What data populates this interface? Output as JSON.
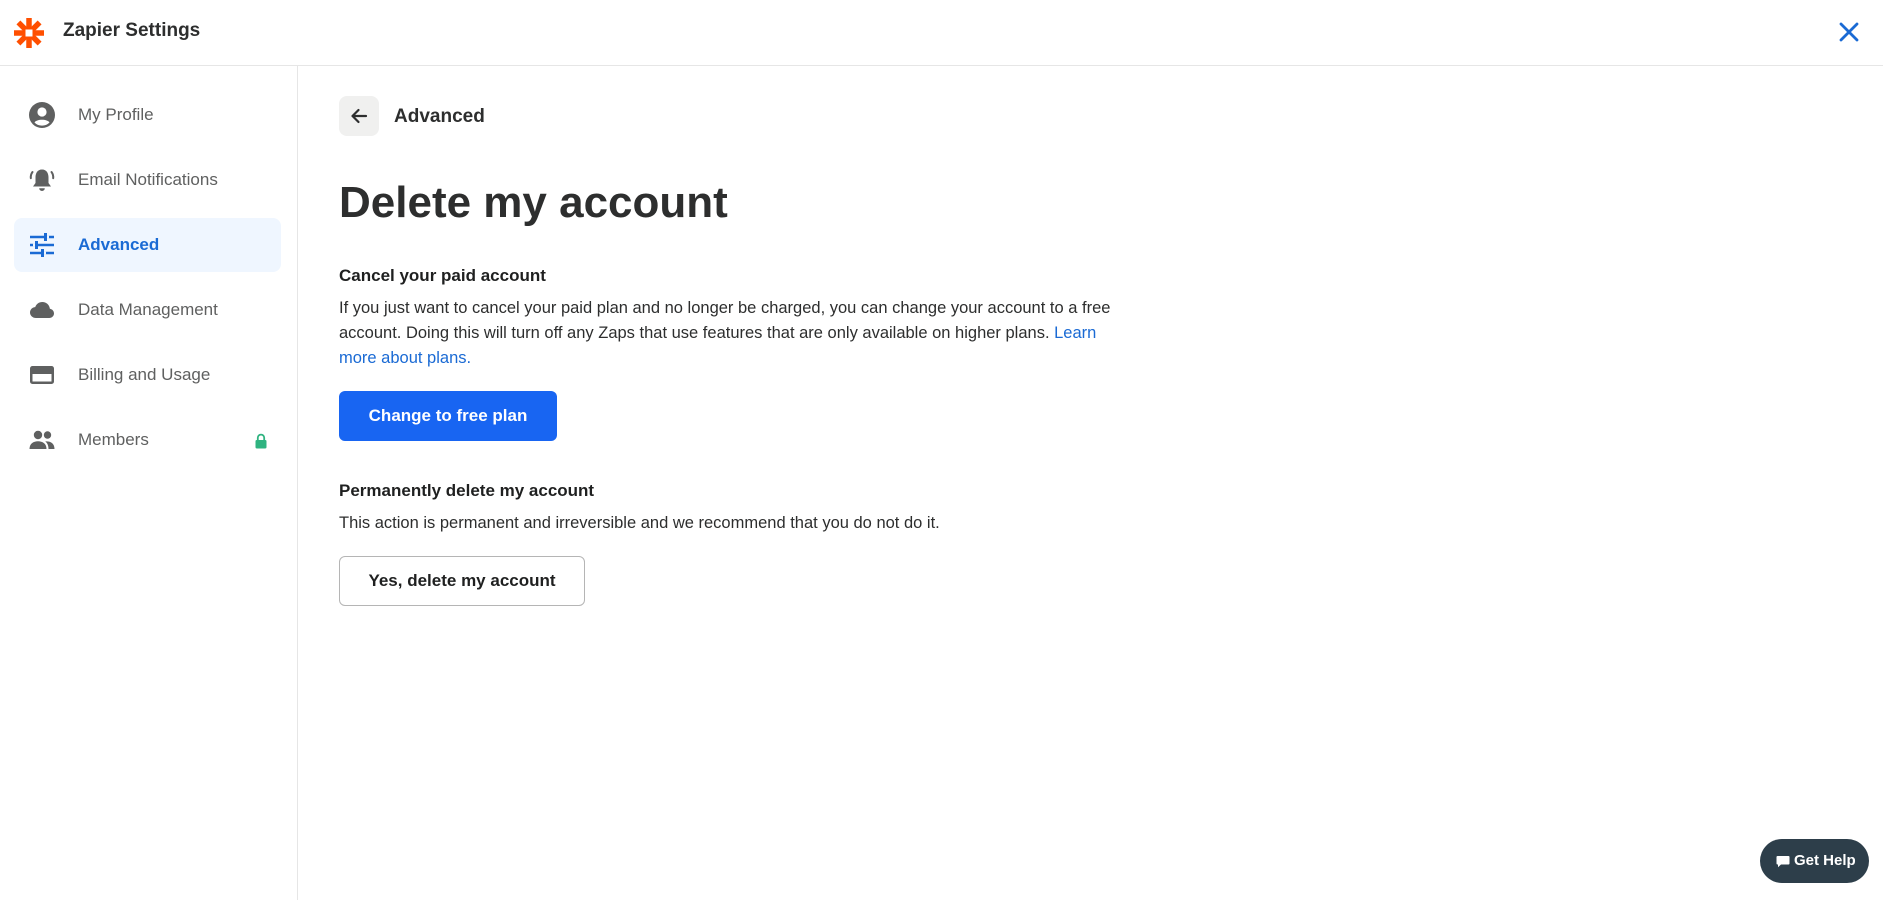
{
  "header": {
    "title": "Zapier Settings",
    "logo_icon": "zapier-asterisk-logo",
    "close_icon": "close-icon",
    "brand_color": "#ff4f00",
    "close_color": "#1a6ad4"
  },
  "sidebar": {
    "items": [
      {
        "label": "My Profile",
        "icon": "account-circle-icon",
        "active": false
      },
      {
        "label": "Email Notifications",
        "icon": "bell-icon",
        "active": false
      },
      {
        "label": "Advanced",
        "icon": "sliders-icon",
        "active": true
      },
      {
        "label": "Data Management",
        "icon": "cloud-icon",
        "active": false
      },
      {
        "label": "Billing and Usage",
        "icon": "credit-card-icon",
        "active": false
      },
      {
        "label": "Members",
        "icon": "people-icon",
        "active": false,
        "locked": true
      }
    ],
    "active_color": "#1a6ad4",
    "active_bg": "#eff6ff",
    "lock_color": "#2fb380"
  },
  "main": {
    "breadcrumb": "Advanced",
    "title": "Delete my account",
    "cancel_section": {
      "title": "Cancel your paid account",
      "body": "If you just want to cancel your paid plan and no longer be charged, you can change your account to a free account. Doing this will turn off any Zaps that use features that are only available on higher plans.",
      "link": "Learn more about plans.",
      "button": "Change to free plan"
    },
    "delete_section": {
      "title": "Permanently delete my account",
      "body": "This action is permanent and irreversible and we recommend that you do not do it.",
      "button": "Yes, delete my account"
    }
  },
  "help": {
    "label": "Get Help",
    "icon": "chat-bubble-icon"
  }
}
